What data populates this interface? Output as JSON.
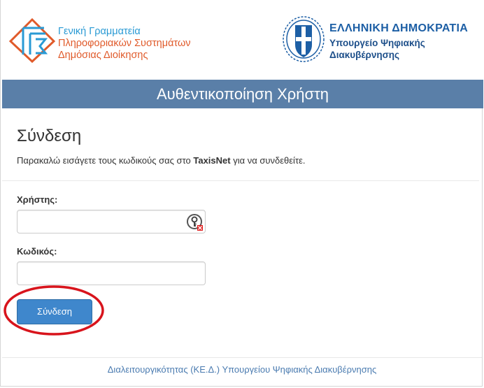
{
  "header": {
    "gsis": {
      "line1": "Γενική Γραμματεία",
      "line2": "Πληροφοριακών Συστημάτων",
      "line3": "Δημόσιας Διοίκησης"
    },
    "republic": {
      "line1": "ΕΛΛΗΝΙΚΗ ΔΗΜΟΚΡΑΤΙΑ",
      "line2": "Υπουργείο Ψηφιακής",
      "line3": "Διακυβέρνησης"
    }
  },
  "title_bar": "Αυθεντικοποίηση Χρήστη",
  "login": {
    "heading": "Σύνδεση",
    "desc_prefix": "Παρακαλώ εισάγετε τους κωδικούς σας στο ",
    "desc_bold": "TaxisNet",
    "desc_suffix": " για να συνδεθείτε.",
    "user_label": "Χρήστης:",
    "user_value": "",
    "password_label": "Κωδικός:",
    "password_value": "",
    "submit_label": "Σύνδεση"
  },
  "footer": "Διαλειτουργικότητας (ΚΕ.Δ.) Υπουργείου Ψηφιακής Διακυβέρνησης",
  "colors": {
    "title_bar": "#5a7fa8",
    "button": "#3f87cc",
    "annotation_circle": "#d8141c",
    "gsis_blue": "#2a9ad4",
    "gsis_orange": "#e05a2a",
    "republic_blue": "#1d5fa5"
  },
  "icons": {
    "gsis_logo": "gsis-logo-icon",
    "emblem": "greek-emblem-icon",
    "password_manager": "key-icon"
  }
}
